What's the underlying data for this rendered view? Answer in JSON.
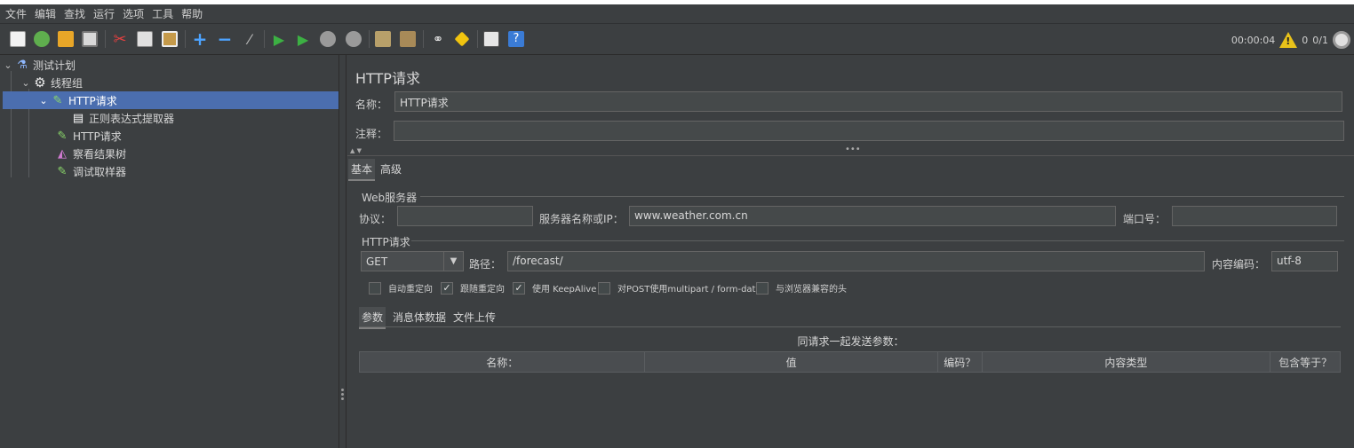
{
  "menu": [
    "文件",
    "编辑",
    "查找",
    "运行",
    "选项",
    "工具",
    "帮助"
  ],
  "toolbar": {
    "icons": [
      "new-icon",
      "templates-icon",
      "open-icon",
      "save-icon",
      "cut-icon",
      "copy-icon",
      "paste-icon",
      "expand-icon",
      "collapse-icon",
      "toggle-icon",
      "start-icon",
      "start-no-pause-icon",
      "stop-icon",
      "shutdown-icon",
      "clear-icon",
      "clear-all-icon",
      "search-icon",
      "reset-search-icon",
      "function-helper-icon",
      "help-icon"
    ]
  },
  "status": {
    "timer": "00:00:04",
    "warnings": "0",
    "threads": "0/1"
  },
  "tree": [
    {
      "label": "测试计划",
      "icon": "test-plan-icon",
      "expanded": true
    },
    {
      "label": "线程组",
      "icon": "thread-group-icon",
      "expanded": true
    },
    {
      "label": "HTTP请求",
      "icon": "http-sampler-icon",
      "expanded": true,
      "selected": true
    },
    {
      "label": "正则表达式提取器",
      "icon": "regex-extractor-icon"
    },
    {
      "label": "HTTP请求",
      "icon": "http-sampler-icon"
    },
    {
      "label": "察看结果树",
      "icon": "results-tree-icon"
    },
    {
      "label": "调试取样器",
      "icon": "debug-sampler-icon"
    }
  ],
  "panel": {
    "title": "HTTP请求",
    "name_label": "名称：",
    "name_value": "HTTP请求",
    "comment_label": "注释：",
    "comment_value": "",
    "tabs": [
      "基本",
      "高级"
    ],
    "web_server": {
      "title": "Web服务器",
      "protocol_label": "协议：",
      "protocol_value": "",
      "server_label": "服务器名称或IP：",
      "server_value": "www.weather.com.cn",
      "port_label": "端口号：",
      "port_value": ""
    },
    "http_request": {
      "title": "HTTP请求",
      "method": "GET",
      "path_label": "路径：",
      "path_value": "/forecast/",
      "encoding_label": "内容编码：",
      "encoding_value": "utf-8"
    },
    "options": [
      {
        "label": "自动重定向",
        "checked": false
      },
      {
        "label": "跟随重定向",
        "checked": true
      },
      {
        "label": "使用 KeepAlive",
        "checked": true
      },
      {
        "label": "对POST使用multipart / form-data",
        "checked": false
      },
      {
        "label": "与浏览器兼容的头",
        "checked": false
      }
    ],
    "sub_tabs": [
      "参数",
      "消息体数据",
      "文件上传"
    ],
    "params_caption": "同请求一起发送参数：",
    "columns": [
      "名称：",
      "值",
      "编码？",
      "内容类型",
      "包含等于？"
    ]
  }
}
